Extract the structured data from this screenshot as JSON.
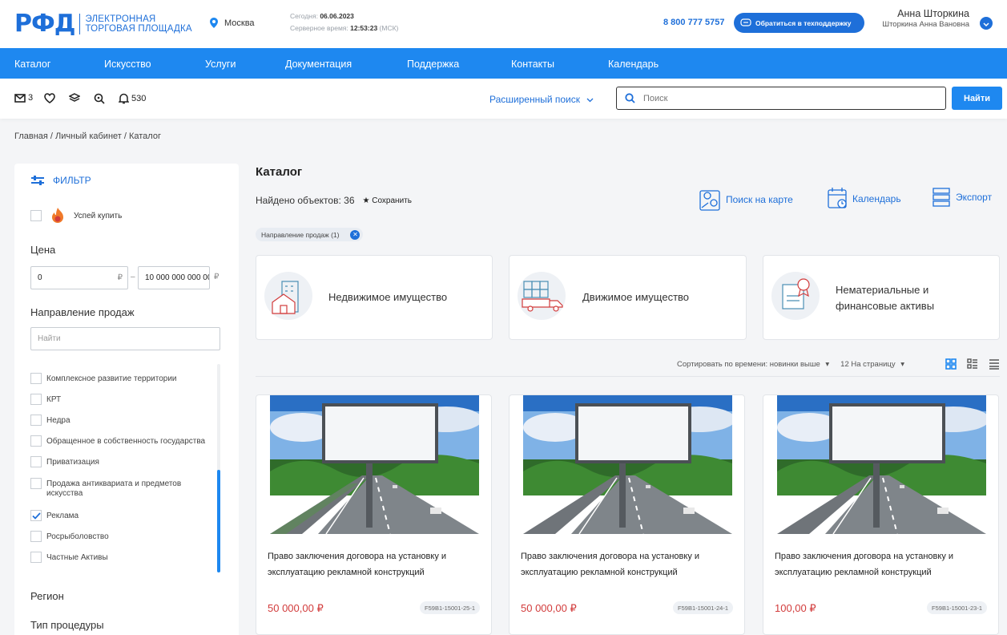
{
  "header": {
    "logo_mark": "РФД",
    "logo_line1": "ЭЛЕКТРОННАЯ",
    "logo_line2": "ТОРГОВАЯ ПЛОЩАДКА",
    "city": "Москва",
    "today_label": "Сегодня:",
    "today_value": "06.06.2023",
    "server_time_label": "Серверное время:",
    "server_time_value": "12:53:23",
    "server_tz": "(МСК)",
    "phone": "8 800 777 5757",
    "support_label": "Обратиться в техподдержку",
    "user_name": "Анна Шторкина",
    "user_fullname": "Шторкина Анна Вановна"
  },
  "nav": {
    "items": [
      "Каталог",
      "Искусство",
      "Услуги",
      "Документация",
      "Поддержка",
      "Контакты",
      "Календарь"
    ]
  },
  "toolbar": {
    "messages_count": "3",
    "notifications_count": "530",
    "advanced_search_label": "Расширенный поиск",
    "search_placeholder": "Поиск",
    "find_button": "Найти"
  },
  "breadcrumb": [
    "Главная",
    "Личный кабинет",
    "Каталог"
  ],
  "filter": {
    "title": "ФИЛЬТР",
    "hurry_label": "Успей купить",
    "price_label": "Цена",
    "price_from": "0",
    "price_to": "10 000 000 000 00",
    "currency": "₽",
    "direction_label": "Направление продаж",
    "direction_search_placeholder": "Найти",
    "direction_items": [
      {
        "label": "Комплексное развитие территории",
        "checked": false
      },
      {
        "label": "КРТ",
        "checked": false
      },
      {
        "label": "Недра",
        "checked": false
      },
      {
        "label": "Обращенное в собственность государства",
        "checked": false
      },
      {
        "label": "Приватизация",
        "checked": false
      },
      {
        "label": "Продажа антиквариата и предметов искусства",
        "checked": false
      },
      {
        "label": "Реклама",
        "checked": true
      },
      {
        "label": "Росрыболовство",
        "checked": false
      },
      {
        "label": "Частные Активы",
        "checked": false
      }
    ],
    "region_label": "Регион",
    "procedure_label": "Тип процедуры"
  },
  "catalog": {
    "title": "Каталог",
    "found_label": "Найдено объектов: 36",
    "save_label": "Сохранить",
    "actions": [
      "Поиск на карте",
      "Календарь",
      "Экспорт"
    ],
    "active_filter_chip": "Направление продаж (1)",
    "categories": [
      "Недвижимое имущество",
      "Движимое имущество",
      "Нематериальные и финансовые активы"
    ],
    "sort_label": "Сортировать по времени: новинки выше",
    "per_page_label": "12 На страницу",
    "lots": [
      {
        "title": "Право заключения договора на установку и эксплуатацию рекламной конструкций",
        "price": "50 000,00 ₽",
        "code": "F59B1-15001-25-1"
      },
      {
        "title": "Право заключения договора на установку и эксплуатацию рекламной конструкций",
        "price": "50 000,00 ₽",
        "code": "F59B1-15001-24-1"
      },
      {
        "title": "Право заключения договора на установку и эксплуатацию рекламной конструкций",
        "price": "100,00 ₽",
        "code": "F59B1-15001-23-1"
      }
    ]
  },
  "colors": {
    "brand": "#1e6fd9",
    "nav": "#1e88f0",
    "price": "#d23c3c"
  }
}
